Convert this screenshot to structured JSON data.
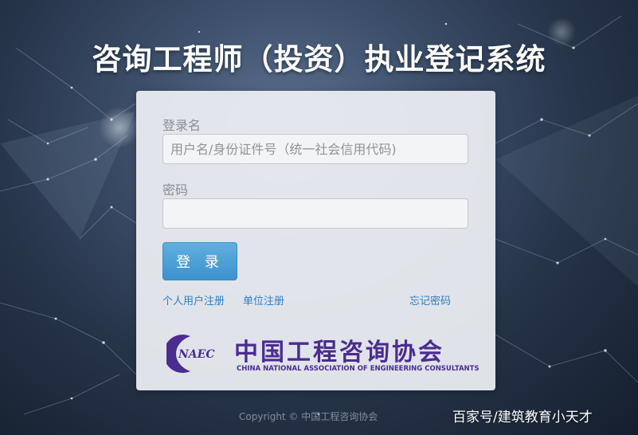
{
  "page": {
    "title": "咨询工程师（投资）执业登记系统"
  },
  "login_form": {
    "username_label": "登录名",
    "username_placeholder": "用户名/身份证件号（统一社会信用代码)",
    "password_label": "密码",
    "password_placeholder": "",
    "login_button": "登 录",
    "links": {
      "personal_register": "个人用户注册",
      "unit_register": "单位注册",
      "forgot_password": "忘记密码"
    }
  },
  "logo": {
    "mark_text": "NAEC",
    "name_cn": "中国工程咨询协会",
    "name_en": "CHINA NATIONAL ASSOCIATION OF ENGINEERING CONSULTANTS",
    "color": "#4b2c8f"
  },
  "footer": {
    "copyright": "Copyright © 中国工程咨询协会"
  },
  "watermark": {
    "text": "百家号/建筑教育小天才"
  },
  "colors": {
    "button": "#4a9fd8",
    "link": "#2f7ec2",
    "background": "#2c3b54"
  }
}
